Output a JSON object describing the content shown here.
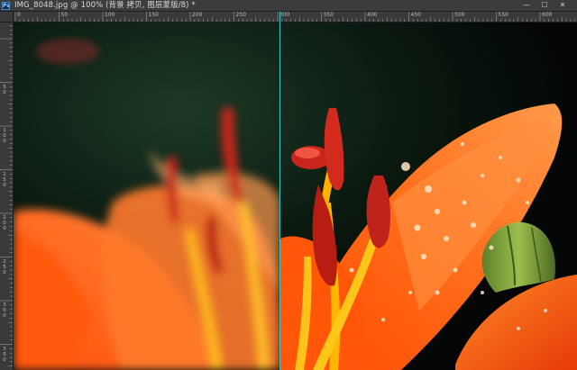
{
  "window": {
    "title": "IMG_8048.jpg @ 100% (背景 拷贝, 图层蒙版/8) *",
    "buttons": {
      "minimize": "—",
      "maximize": "☐",
      "close": "✕"
    },
    "app_icon_label": "Ps"
  },
  "rulers": {
    "horizontal_labels": [
      "0",
      "50",
      "100",
      "150",
      "200",
      "250",
      "300",
      "350",
      "400",
      "450",
      "500",
      "550",
      "600"
    ],
    "vertical_labels": [
      "50",
      "100",
      "150",
      "200",
      "250",
      "300",
      "350",
      "400"
    ]
  },
  "document": {
    "zoom_percent": 100,
    "layer": "背景 拷贝",
    "mask": "图层蒙版/8",
    "colors": {
      "petal_orange": "#ff5a0e",
      "petal_light": "#ff8a3a",
      "stamen_red": "#c8241a",
      "filament_yellow": "#ffb400",
      "background_dark": "#06100a",
      "bud_green": "#7fa13a",
      "guide_cyan": "#35d3d6"
    }
  }
}
